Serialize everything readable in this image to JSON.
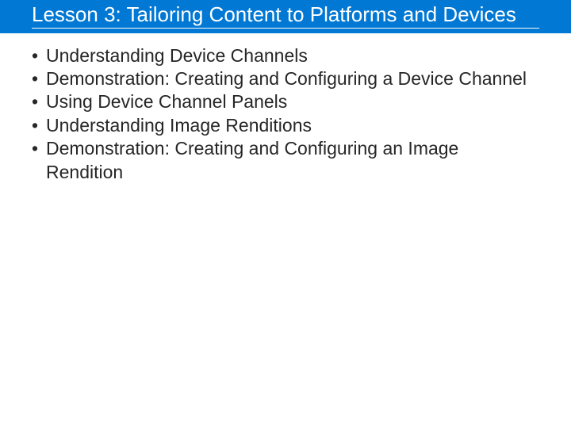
{
  "title": "Lesson 3: Tailoring Content to Platforms and Devices",
  "bullets": [
    "Understanding Device Channels",
    "Demonstration: Creating and Configuring a Device Channel",
    "Using Device Channel Panels",
    "Understanding Image Renditions",
    "Demonstration: Creating and Configuring an Image Rendition"
  ]
}
